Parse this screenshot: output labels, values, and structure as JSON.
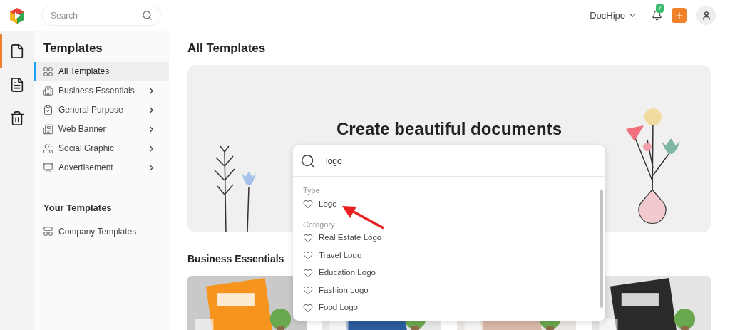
{
  "header": {
    "search": {
      "placeholder": "Search"
    },
    "account": "DocHipo",
    "notifications": "7"
  },
  "rail": [
    {
      "kind": "file",
      "selected": true
    },
    {
      "kind": "document",
      "selected": false
    },
    {
      "kind": "trash",
      "selected": false
    }
  ],
  "sidebar": {
    "title": "Templates",
    "items": [
      {
        "label": "All Templates",
        "selected": true,
        "expandable": false
      },
      {
        "label": "Business Essentials",
        "selected": false,
        "expandable": true
      },
      {
        "label": "General Purpose",
        "selected": false,
        "expandable": true
      },
      {
        "label": "Web Banner",
        "selected": false,
        "expandable": true
      },
      {
        "label": "Social Graphic",
        "selected": false,
        "expandable": true
      },
      {
        "label": "Advertisement",
        "selected": false,
        "expandable": true
      }
    ],
    "your_title": "Your Templates",
    "your_items": [
      {
        "label": "Company Templates",
        "selected": false
      }
    ]
  },
  "main": {
    "title": "All Templates",
    "banner_title": "Create beautiful documents",
    "search": {
      "value": "logo"
    },
    "suggestions": [
      {
        "heading": "Type",
        "items": [
          "Logo"
        ]
      },
      {
        "heading": "Category",
        "items": [
          "Real Estate Logo",
          "Travel Logo",
          "Education Logo",
          "Fashion Logo",
          "Food Logo"
        ]
      }
    ],
    "section_title": "Business Essentials"
  }
}
